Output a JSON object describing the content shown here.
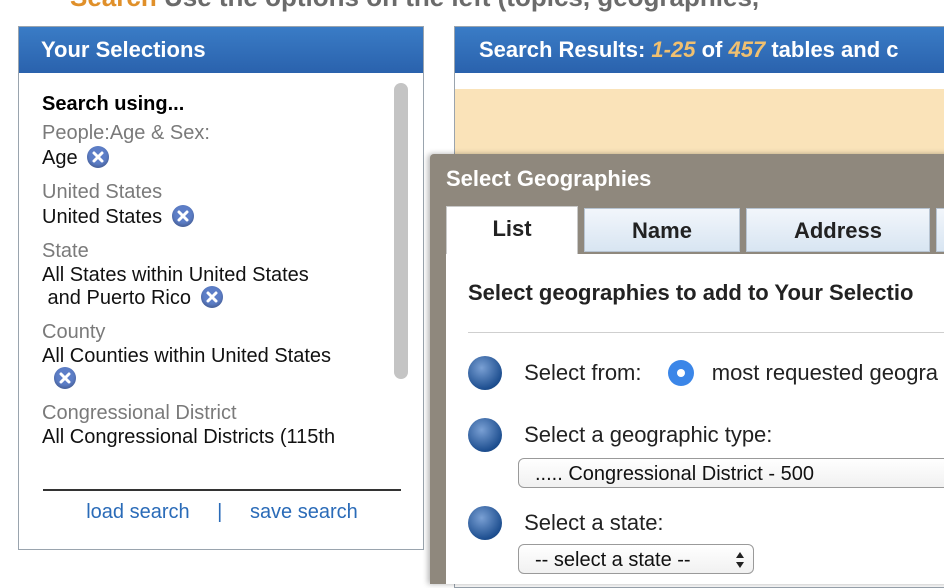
{
  "banner": {
    "accent": "Search",
    "text": "Use the options on the left (topics, geographies,"
  },
  "selections": {
    "title": "Your Selections",
    "search_using": "Search using...",
    "groups": [
      {
        "category": "People:Age & Sex:",
        "values": [
          "Age"
        ]
      },
      {
        "category": "United States",
        "values": [
          "United States"
        ]
      },
      {
        "category": "State",
        "values": [
          "All States within United States",
          " and Puerto Rico"
        ]
      },
      {
        "category": "County",
        "values": [
          "All Counties within United States"
        ]
      },
      {
        "category": "Congressional District",
        "values": [
          "All Congressional Districts (115th"
        ]
      }
    ],
    "load_search": "load search",
    "separator": "|",
    "save_search": "save search"
  },
  "results": {
    "title_prefix": "Search Results:",
    "range": "1-25",
    "of": "of",
    "total": "457",
    "suffix": "tables and c"
  },
  "dialog": {
    "title": "Select Geographies",
    "tabs": [
      "List",
      "Name",
      "Address"
    ],
    "instruction": "Select geographies to add to Your Selectio",
    "steps": {
      "select_from": "Select from:",
      "select_from_option": "most requested geogra",
      "geo_type_label": "Select a geographic type:",
      "geo_type_value": "..... Congressional District - 500",
      "state_label": "Select a state:",
      "state_value": "-- select a state --"
    }
  },
  "colors": {
    "header_blue": "#2a62ad",
    "link_blue": "#2a6bb8",
    "count_gold": "#f0c070",
    "dialog_frame": "#8f887d",
    "peach": "#fae3b9"
  },
  "icons": {
    "remove": "remove-circle-x-icon",
    "step": "blue-ball-bullet-icon",
    "radio": "radio-selected-icon",
    "select_arrows": "updown-arrows-icon"
  }
}
